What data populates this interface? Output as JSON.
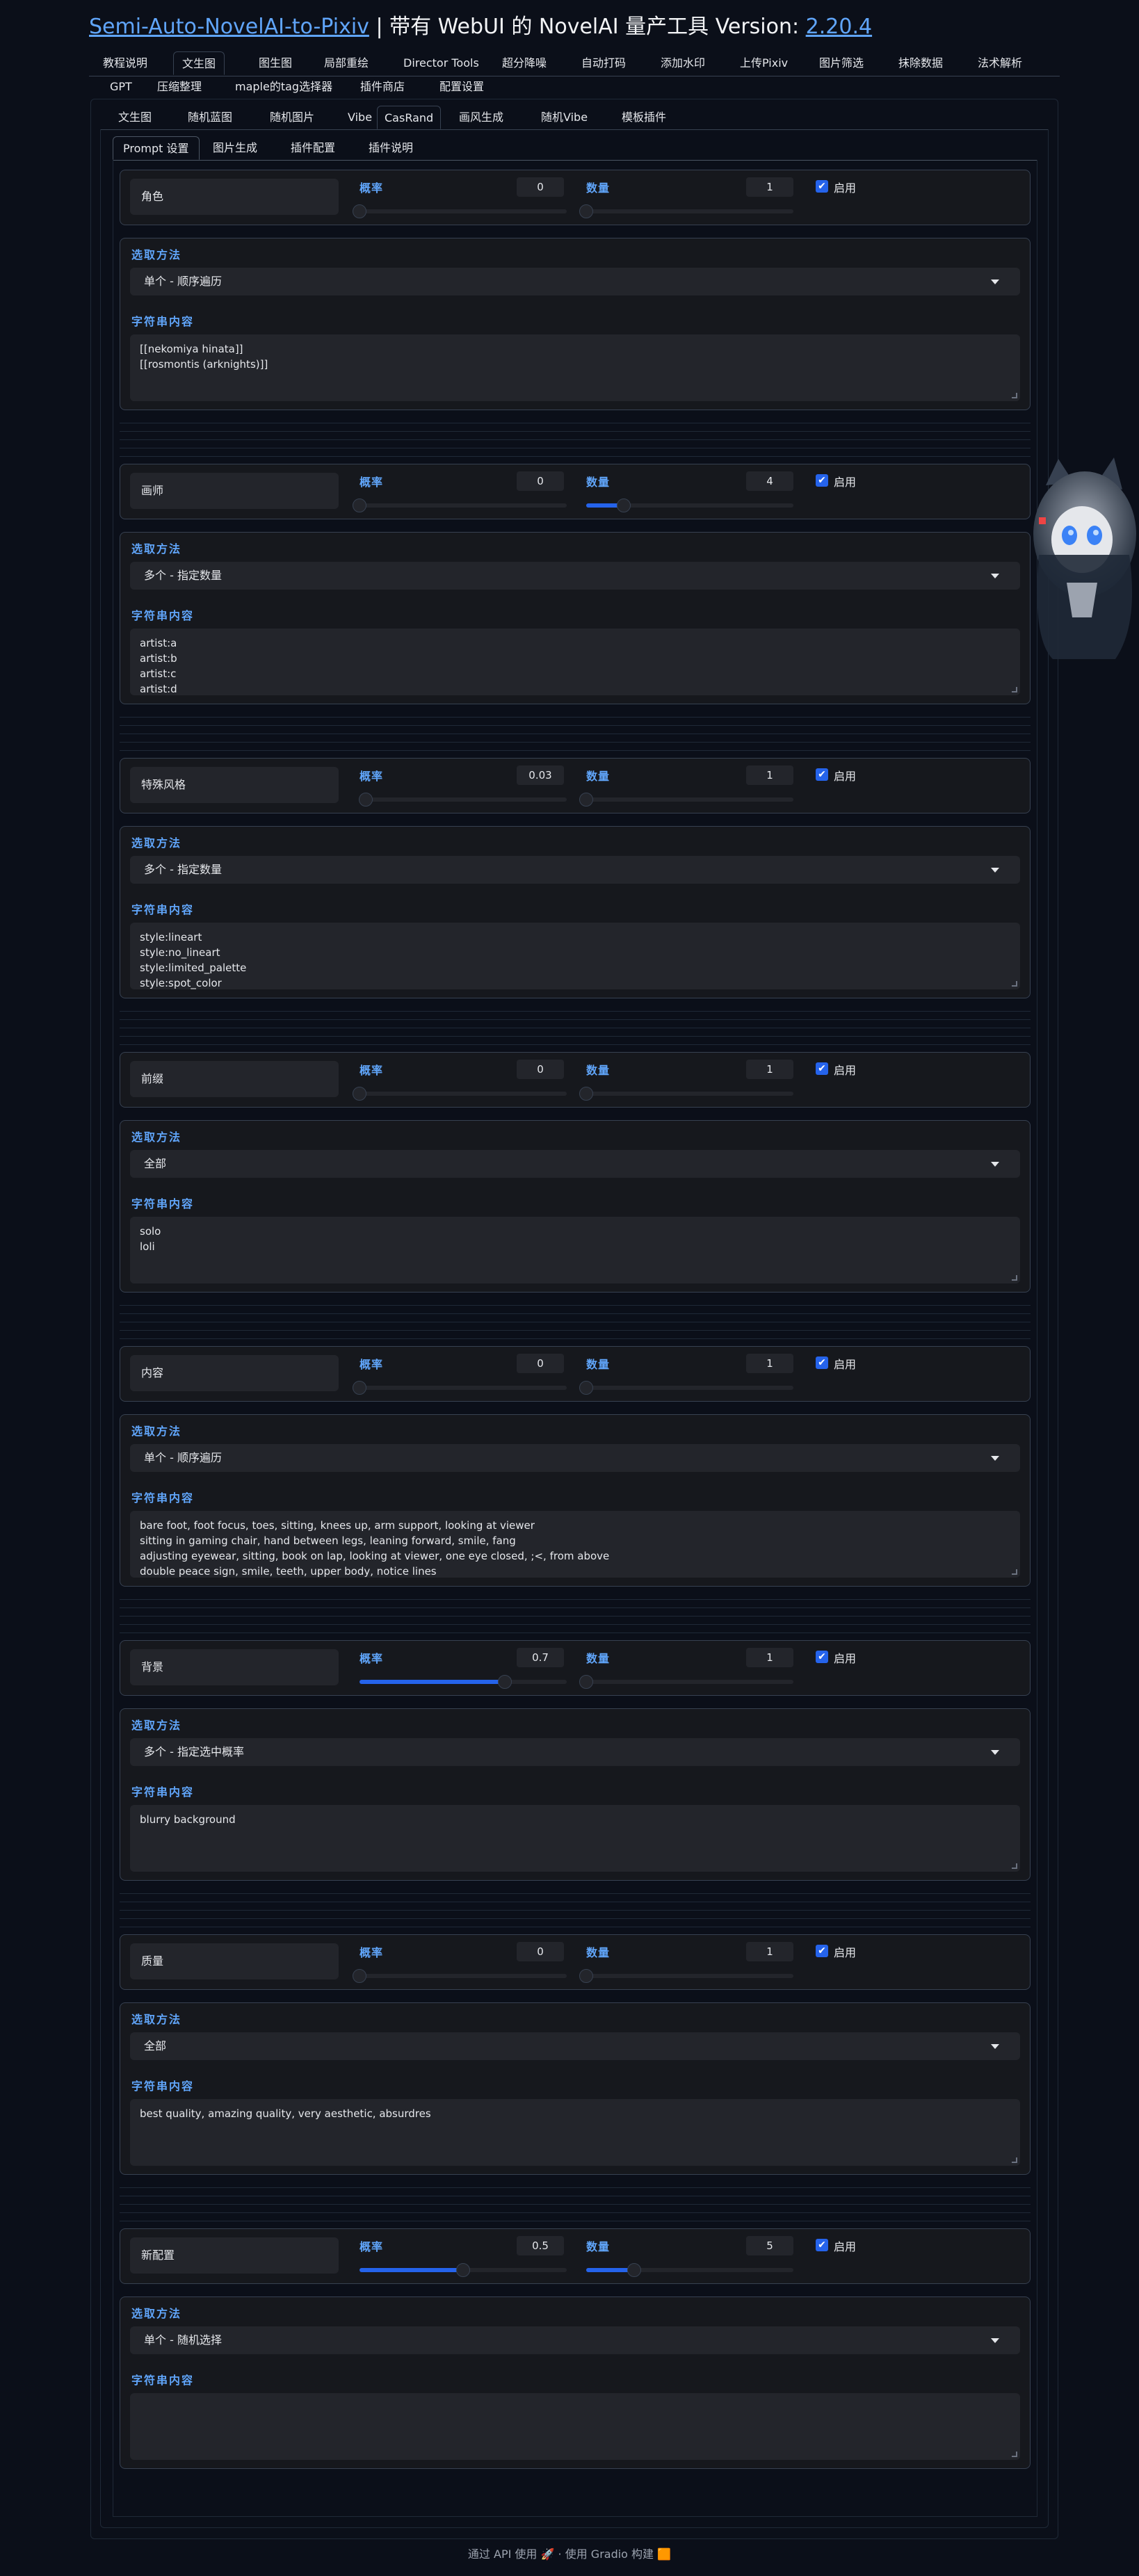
{
  "header": {
    "title_link": "Semi-Auto-NovelAI-to-Pixiv",
    "title_sep": " | ",
    "title_mid": "带有 WebUI 的 NovelAI 量产工具 Version: ",
    "version": "2.20.4"
  },
  "top_tabs": [
    {
      "label": "教程说明"
    },
    {
      "label": "文生图"
    },
    {
      "label": "图生图"
    },
    {
      "label": "局部重绘"
    },
    {
      "label": "Director Tools"
    },
    {
      "label": "超分降噪"
    },
    {
      "label": "自动打码"
    },
    {
      "label": "添加水印"
    },
    {
      "label": "上传Pixiv"
    },
    {
      "label": "图片筛选"
    },
    {
      "label": "抹除数据"
    },
    {
      "label": "法术解析"
    },
    {
      "label": "GPT"
    },
    {
      "label": "压缩整理"
    },
    {
      "label": "maple的tag选择器"
    },
    {
      "label": "插件商店"
    },
    {
      "label": "配置设置"
    }
  ],
  "sub_tabs": [
    {
      "label": "文生图"
    },
    {
      "label": "随机蓝图"
    },
    {
      "label": "随机图片"
    },
    {
      "label": "Vibe"
    },
    {
      "label": "CasRand"
    },
    {
      "label": "画风生成"
    },
    {
      "label": "随机Vibe"
    },
    {
      "label": "模板插件"
    }
  ],
  "prompt_tabs": [
    {
      "label": "Prompt 设置"
    },
    {
      "label": "图片生成"
    },
    {
      "label": "插件配置"
    },
    {
      "label": "插件说明"
    }
  ],
  "labels": {
    "prob": "概率",
    "count": "数量",
    "enable": "启用",
    "method": "选取方法",
    "content": "字符串内容"
  },
  "groups": [
    {
      "name": "角色",
      "prob": "0",
      "prob_frac": 0,
      "count": "1",
      "count_frac": 0,
      "method": "单个 - 顺序遍历",
      "content": "[[nekomiya hinata]]\n[[rosmontis (arknights)]]"
    },
    {
      "name": "画师",
      "prob": "0",
      "prob_frac": 0,
      "count": "4",
      "count_frac": 0.18,
      "method": "多个 - 指定数量",
      "content": "artist:a\nartist:b\nartist:c\nartist:d"
    },
    {
      "name": "特殊风格",
      "prob": "0.03",
      "prob_frac": 0.03,
      "count": "1",
      "count_frac": 0,
      "method": "多个 - 指定数量",
      "content": "style:lineart\nstyle:no_lineart\nstyle:limited_palette\nstyle:spot_color"
    },
    {
      "name": "前缀",
      "prob": "0",
      "prob_frac": 0,
      "count": "1",
      "count_frac": 0,
      "method": "全部",
      "content": "solo\nloli"
    },
    {
      "name": "内容",
      "prob": "0",
      "prob_frac": 0,
      "count": "1",
      "count_frac": 0,
      "method": "单个 - 顺序遍历",
      "content": "bare foot, foot focus, toes, sitting, knees up, arm support, looking at viewer\nsitting in gaming chair, hand between legs, leaning forward, smile, fang\nadjusting eyewear, sitting, book on lap, looking at viewer, one eye closed, ;<, from above\ndouble peace sign, smile, teeth, upper body, notice lines"
    },
    {
      "name": "背景",
      "prob": "0.7",
      "prob_frac": 0.7,
      "count": "1",
      "count_frac": 0,
      "method": "多个 - 指定选中概率",
      "content": "blurry background"
    },
    {
      "name": "质量",
      "prob": "0",
      "prob_frac": 0,
      "count": "1",
      "count_frac": 0,
      "method": "全部",
      "content": "best quality, amazing quality, very aesthetic, absurdres"
    },
    {
      "name": "新配置",
      "prob": "0.5",
      "prob_frac": 0.5,
      "count": "5",
      "count_frac": 0.23,
      "method": "单个 - 随机选择",
      "content": ""
    }
  ],
  "footer": {
    "api": "通过 API 使用",
    "sep": " · ",
    "built": "使用 Gradio 构建"
  },
  "colors": {
    "accent": "#2563eb",
    "label": "#60a5fa",
    "bg": "#0b0f19",
    "panel": "#16181d",
    "field": "#23252b"
  }
}
